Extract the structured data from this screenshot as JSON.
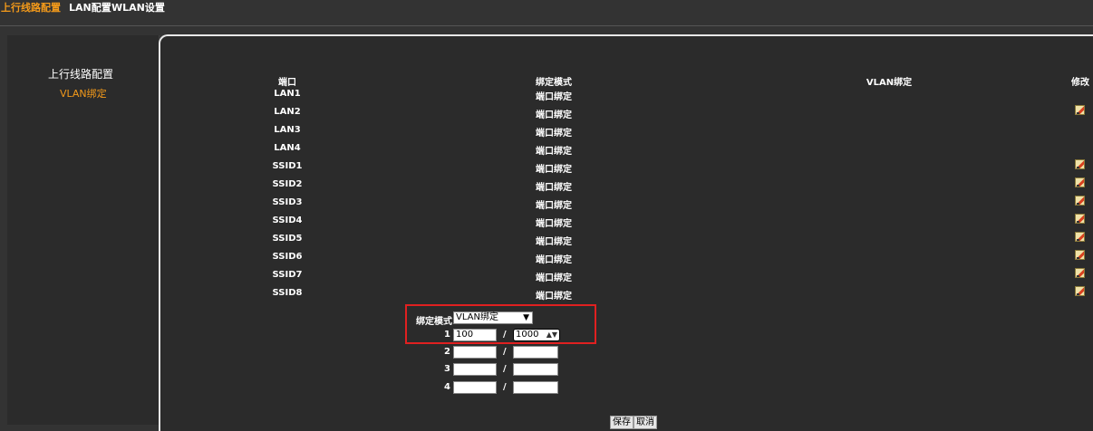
{
  "nav": {
    "tab1": "上行线路配置",
    "tab2": "LAN配置",
    "tab3": "WLAN设置"
  },
  "sidebar": {
    "item1": "上行线路配置",
    "item2": "VLAN绑定"
  },
  "table": {
    "headers": [
      "端口",
      "绑定模式",
      "VLAN绑定",
      "修改"
    ],
    "rows": [
      {
        "port": "LAN1",
        "mode": "端口绑定",
        "vlan": "",
        "editable": false
      },
      {
        "port": "LAN2",
        "mode": "端口绑定",
        "vlan": "",
        "editable": true
      },
      {
        "port": "LAN3",
        "mode": "端口绑定",
        "vlan": "",
        "editable": false
      },
      {
        "port": "LAN4",
        "mode": "端口绑定",
        "vlan": "",
        "editable": false
      },
      {
        "port": "SSID1",
        "mode": "端口绑定",
        "vlan": "",
        "editable": true
      },
      {
        "port": "SSID2",
        "mode": "端口绑定",
        "vlan": "",
        "editable": true
      },
      {
        "port": "SSID3",
        "mode": "端口绑定",
        "vlan": "",
        "editable": true
      },
      {
        "port": "SSID4",
        "mode": "端口绑定",
        "vlan": "",
        "editable": true
      },
      {
        "port": "SSID5",
        "mode": "端口绑定",
        "vlan": "",
        "editable": true
      },
      {
        "port": "SSID6",
        "mode": "端口绑定",
        "vlan": "",
        "editable": true
      },
      {
        "port": "SSID7",
        "mode": "端口绑定",
        "vlan": "",
        "editable": true
      },
      {
        "port": "SSID8",
        "mode": "端口绑定",
        "vlan": "",
        "editable": true
      }
    ]
  },
  "form": {
    "mode_label": "绑定模式",
    "mode_value": "VLAN绑定",
    "separator": "/",
    "pairs": [
      {
        "index": "1",
        "a": "100",
        "b": "1000"
      },
      {
        "index": "2",
        "a": "",
        "b": ""
      },
      {
        "index": "3",
        "a": "",
        "b": ""
      },
      {
        "index": "4",
        "a": "",
        "b": ""
      }
    ],
    "save_label": "保存",
    "cancel_label": "取消"
  },
  "colors": {
    "accent": "#f49a1a",
    "highlight": "#e02020",
    "panel_bg": "#2b2b2b"
  }
}
